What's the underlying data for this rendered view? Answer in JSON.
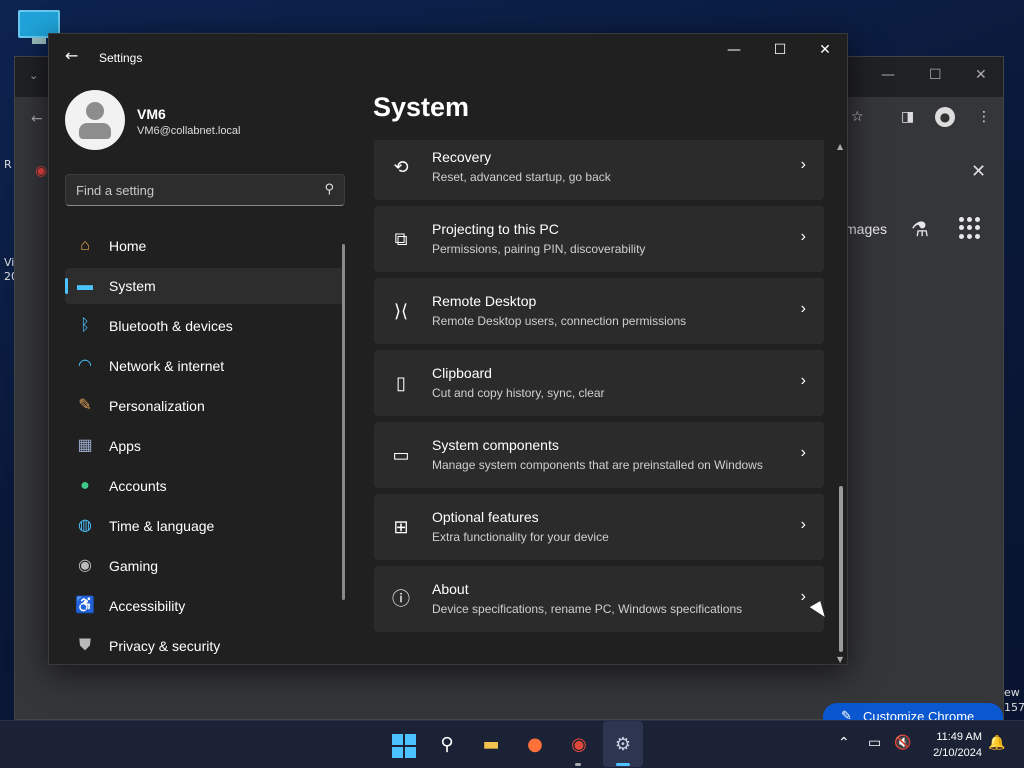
{
  "desktop": {
    "left_text_1": "Vi",
    "left_text_2": "20",
    "left_text_3": "R",
    "right_text_1": "ew",
    "right_text_2": "157"
  },
  "chrome": {
    "images_label": "mages",
    "customize_label": "Customize Chrome"
  },
  "settings": {
    "window_title": "Settings",
    "profile": {
      "name": "VM6",
      "email": "VM6@collabnet.local"
    },
    "search": {
      "placeholder": "Find a setting"
    },
    "nav": [
      {
        "label": "Home",
        "icon": "home-icon",
        "active": false
      },
      {
        "label": "System",
        "icon": "system-icon",
        "active": true
      },
      {
        "label": "Bluetooth & devices",
        "icon": "bluetooth-icon",
        "active": false
      },
      {
        "label": "Network & internet",
        "icon": "wifi-icon",
        "active": false
      },
      {
        "label": "Personalization",
        "icon": "brush-icon",
        "active": false
      },
      {
        "label": "Apps",
        "icon": "apps-icon",
        "active": false
      },
      {
        "label": "Accounts",
        "icon": "accounts-icon",
        "active": false
      },
      {
        "label": "Time & language",
        "icon": "globe-icon",
        "active": false
      },
      {
        "label": "Gaming",
        "icon": "gamepad-icon",
        "active": false
      },
      {
        "label": "Accessibility",
        "icon": "accessibility-icon",
        "active": false
      },
      {
        "label": "Privacy & security",
        "icon": "shield-icon",
        "active": false
      }
    ],
    "page_title": "System",
    "items": [
      {
        "title": "Recovery",
        "subtitle": "Reset, advanced startup, go back",
        "icon": "recovery-icon"
      },
      {
        "title": "Projecting to this PC",
        "subtitle": "Permissions, pairing PIN, discoverability",
        "icon": "projecting-icon"
      },
      {
        "title": "Remote Desktop",
        "subtitle": "Remote Desktop users, connection permissions",
        "icon": "remote-desktop-icon"
      },
      {
        "title": "Clipboard",
        "subtitle": "Cut and copy history, sync, clear",
        "icon": "clipboard-icon"
      },
      {
        "title": "System components",
        "subtitle": "Manage system components that are preinstalled on Windows",
        "icon": "system-components-icon"
      },
      {
        "title": "Optional features",
        "subtitle": "Extra functionality for your device",
        "icon": "optional-features-icon"
      },
      {
        "title": "About",
        "subtitle": "Device specifications, rename PC, Windows specifications",
        "icon": "info-icon"
      }
    ]
  },
  "taskbar": {
    "time": "11:49 AM",
    "date": "2/10/2024"
  },
  "colors": {
    "accent": "#4cc2ff",
    "window_bg": "#202020",
    "card_bg": "#2b2b2b"
  }
}
